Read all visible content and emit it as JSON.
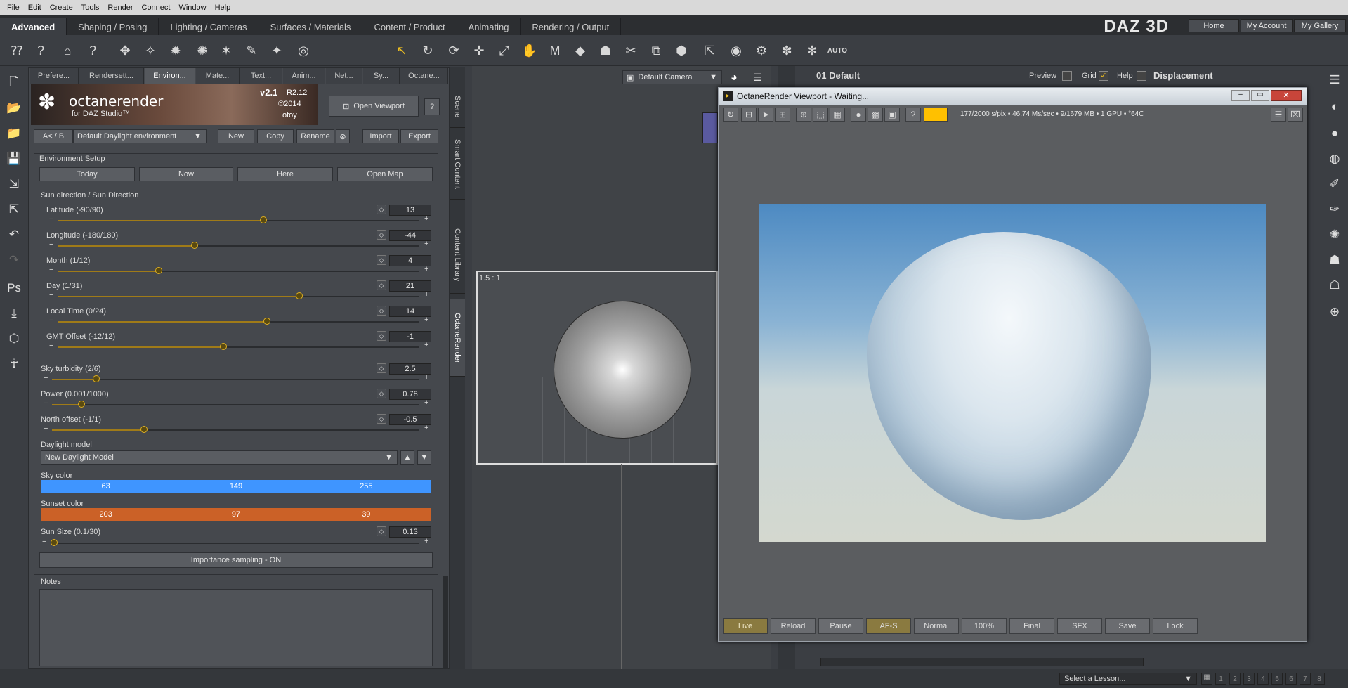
{
  "menu": [
    "File",
    "Edit",
    "Create",
    "Tools",
    "Render",
    "Connect",
    "Window",
    "Help"
  ],
  "workspace_tabs": [
    "Advanced",
    "Shaping / Posing",
    "Lighting / Cameras",
    "Surfaces / Materials",
    "Content / Product",
    "Animating",
    "Rendering / Output"
  ],
  "brand": "DAZ 3D",
  "top_links": [
    "Home",
    "My Account",
    "My Gallery"
  ],
  "panel_tabs": [
    "Prefere...",
    "Rendersett...",
    "Environ...",
    "Mate...",
    "Text...",
    "Anim...",
    "Net...",
    "Sy...",
    "Octane..."
  ],
  "banner": {
    "logo": "octanerender",
    "sub": "for DAZ Studio™",
    "version": "v2.1",
    "revision": "R2.12",
    "copyright": "©2014",
    "company": "otoy"
  },
  "open_viewport": "Open Viewport",
  "help": "?",
  "ab": "A< / B",
  "environment_preset": "Default Daylight environment",
  "preset_buttons": [
    "New",
    "Copy",
    "Rename",
    "Import",
    "Export"
  ],
  "env_setup": {
    "title": "Environment Setup",
    "buttons": [
      "Today",
      "Now",
      "Here",
      "Open Map"
    ],
    "sun_dir_title": "Sun direction / Sun Direction"
  },
  "params": [
    {
      "label": "Latitude  (-90/90)",
      "value": "13",
      "pos": 0.57
    },
    {
      "label": "Longitude  (-180/180)",
      "value": "-44",
      "pos": 0.38
    },
    {
      "label": "Month  (1/12)",
      "value": "4",
      "pos": 0.28
    },
    {
      "label": "Day  (1/31)",
      "value": "21",
      "pos": 0.67
    },
    {
      "label": "Local Time  (0/24)",
      "value": "14",
      "pos": 0.58
    },
    {
      "label": "GMT Offset  (-12/12)",
      "value": "-1",
      "pos": 0.46
    }
  ],
  "params2": [
    {
      "label": "Sky turbidity  (2/6)",
      "value": "2.5",
      "pos": 0.12
    },
    {
      "label": "Power  (0.001/1000)",
      "value": "0.78",
      "pos": 0.08
    },
    {
      "label": "North offset  (-1/1)",
      "value": "-0.5",
      "pos": 0.25
    }
  ],
  "daylight_model_label": "Daylight model",
  "daylight_model": "New Daylight Model",
  "sky_color": {
    "label": "Sky color",
    "r": "63",
    "g": "149",
    "b": "255",
    "hex": "#3f95ff"
  },
  "sunset_color": {
    "label": "Sunset color",
    "r": "203",
    "g": "97",
    "b": "39",
    "hex": "#cb6127"
  },
  "sun_size": {
    "label": "Sun Size  (0.1/30)",
    "value": "0.13",
    "pos": 0.01
  },
  "importance": "Importance sampling - ON",
  "notes": "Notes",
  "side_tabs": [
    "Scene",
    "Smart Content",
    "Content Library",
    "OctaneRender"
  ],
  "viewport": {
    "camera": "Default Camera",
    "ratio": "1.5 : 1"
  },
  "params_panel": {
    "title": "01 Default",
    "preview": "Preview",
    "grid": "Grid",
    "help": "Help",
    "displacement": "Displacement"
  },
  "octane": {
    "title": "OctaneRender Viewport - Waiting...",
    "stats": "177/2000 s/pix • 46.74 Ms/sec • 9/1679 MB • 1 GPU • °64C",
    "bottom": [
      "Live",
      "Reload",
      "Pause",
      "AF-S",
      "Normal",
      "100%",
      "Final",
      "SFX",
      "Save",
      "Lock"
    ]
  },
  "lesson": "Select a Lesson...",
  "pages": [
    "1",
    "2",
    "3",
    "4",
    "5",
    "6",
    "7",
    "8"
  ]
}
